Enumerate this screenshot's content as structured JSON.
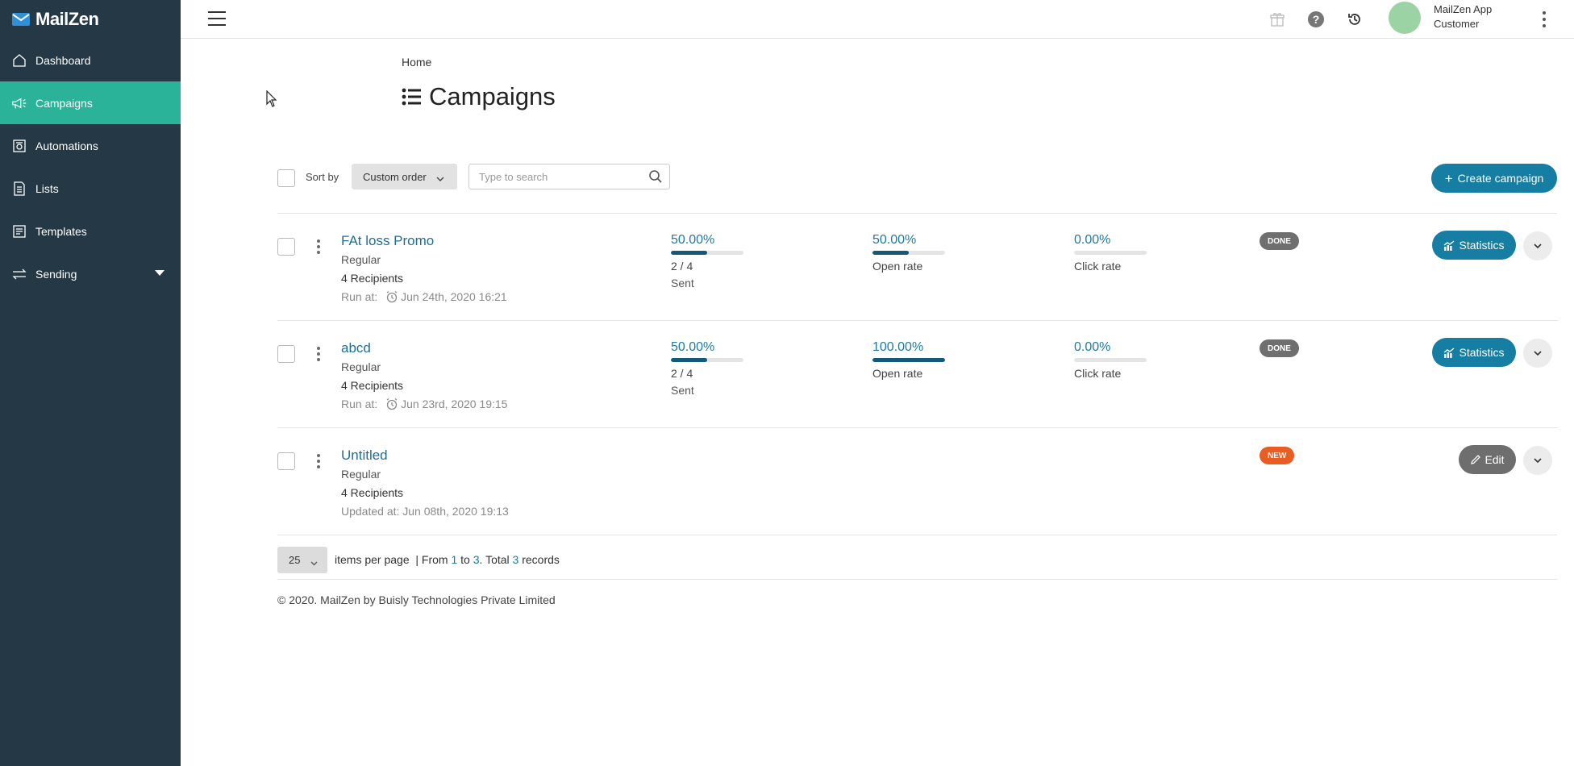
{
  "app": {
    "name": "MailZen"
  },
  "sidebar": {
    "items": [
      {
        "label": "Dashboard",
        "icon": "home-icon",
        "active": false
      },
      {
        "label": "Campaigns",
        "icon": "megaphone-icon",
        "active": true
      },
      {
        "label": "Automations",
        "icon": "automation-icon",
        "active": false
      },
      {
        "label": "Lists",
        "icon": "list-document-icon",
        "active": false
      },
      {
        "label": "Templates",
        "icon": "template-icon",
        "active": false
      },
      {
        "label": "Sending",
        "icon": "sending-arrows-icon",
        "active": false,
        "has_dropdown": true
      }
    ]
  },
  "topbar": {
    "icons": [
      "gift-icon",
      "help-icon",
      "history-icon"
    ],
    "user": {
      "line1": "MailZen App",
      "line2": "Customer"
    }
  },
  "header": {
    "breadcrumb": "Home",
    "title": "Campaigns"
  },
  "toolbar": {
    "sort_label": "Sort by",
    "sort_value": "Custom order",
    "search_placeholder": "Type to search",
    "create_label": "Create campaign"
  },
  "campaigns": [
    {
      "name": "FAt loss Promo",
      "type": "Regular",
      "recipients": "4 Recipients",
      "when_label": "Run at:",
      "when_value": "Jun 24th, 2020 16:21",
      "status": "DONE",
      "sent": {
        "pct": "50.00%",
        "fraction": 0.5,
        "count": "2 / 4",
        "label": "Sent"
      },
      "open": {
        "pct": "50.00%",
        "fraction": 0.5,
        "label": "Open rate"
      },
      "click": {
        "pct": "0.00%",
        "fraction": 0.0,
        "label": "Click rate"
      },
      "action_label": "Statistics"
    },
    {
      "name": "abcd",
      "type": "Regular",
      "recipients": "4 Recipients",
      "when_label": "Run at:",
      "when_value": "Jun 23rd, 2020 19:15",
      "status": "DONE",
      "sent": {
        "pct": "50.00%",
        "fraction": 0.5,
        "count": "2 / 4",
        "label": "Sent"
      },
      "open": {
        "pct": "100.00%",
        "fraction": 1.0,
        "label": "Open rate"
      },
      "click": {
        "pct": "0.00%",
        "fraction": 0.0,
        "label": "Click rate"
      },
      "action_label": "Statistics"
    },
    {
      "name": "Untitled",
      "type": "Regular",
      "recipients": "4 Recipients",
      "when_label": "Updated at: Jun 08th, 2020 19:13",
      "status": "NEW",
      "action_label": "Edit"
    }
  ],
  "pagination": {
    "per_page": "25",
    "per_page_label": "items per page",
    "separator": "| From",
    "from": "1",
    "to_label": "to",
    "to": "3",
    "total_label": ". Total",
    "total": "3",
    "records_label": "records"
  },
  "footer": {
    "text": "© 2020. MailZen by Buisly Technologies Private Limited"
  },
  "colors": {
    "sidebar_bg": "#243846",
    "active_nav": "#2bb39a",
    "primary": "#167da3",
    "done_badge": "#6f6f6f",
    "new_badge": "#e85d22",
    "progress_fill": "#14587a"
  }
}
